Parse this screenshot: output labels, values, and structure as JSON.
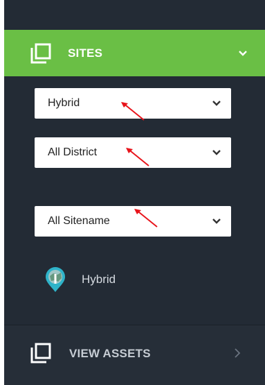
{
  "theme": {
    "accent": "#6abf45",
    "sidebar_bg": "#232b35",
    "arrow": "#e8141b",
    "pin": "#2fb3c9"
  },
  "nav": {
    "sites": {
      "label": "SITES",
      "icon": "copy-icon",
      "state": "expanded"
    },
    "view_assets": {
      "label": "VIEW ASSETS",
      "icon": "copy-icon"
    }
  },
  "filters": {
    "type": {
      "value": "Hybrid"
    },
    "district": {
      "value": "All District"
    },
    "sitename": {
      "value": "All Sitename"
    }
  },
  "sites_list": [
    {
      "label": "Hybrid",
      "icon": "map-pin-icon"
    }
  ]
}
